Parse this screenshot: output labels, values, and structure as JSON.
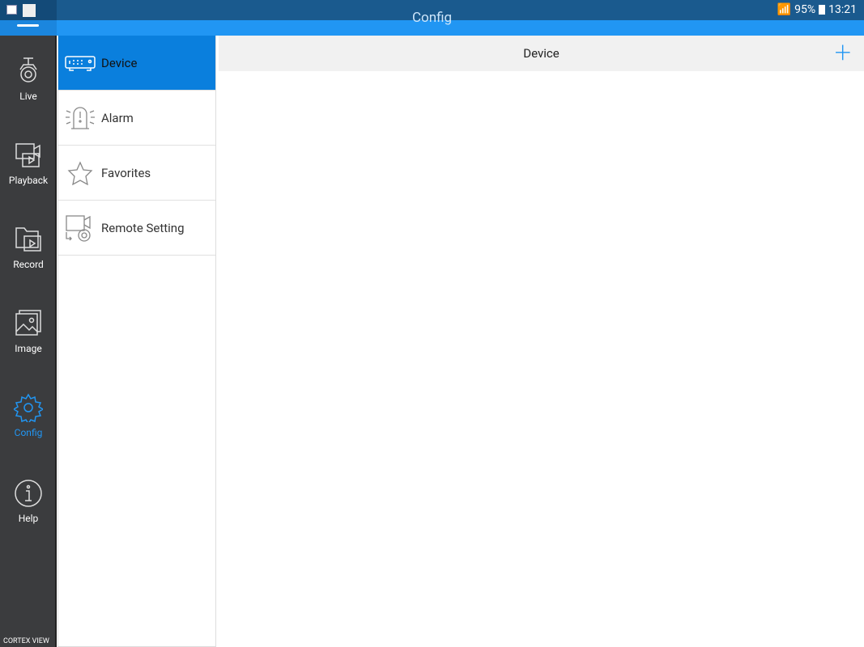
{
  "status": {
    "battery": "95%",
    "time": "13:21"
  },
  "header": {
    "title": "Config"
  },
  "sidebar": {
    "items": [
      {
        "label": "Live"
      },
      {
        "label": "Playback"
      },
      {
        "label": "Record"
      },
      {
        "label": "Image"
      },
      {
        "label": "Config",
        "active": true
      },
      {
        "label": "Help"
      }
    ],
    "brand": "CORTEX VIEW"
  },
  "menu": {
    "items": [
      {
        "label": "Device",
        "active": true
      },
      {
        "label": "Alarm"
      },
      {
        "label": "Favorites"
      },
      {
        "label": "Remote Setting"
      }
    ]
  },
  "main": {
    "title": "Device",
    "add_label": "+"
  },
  "colors": {
    "accent": "#2196f3",
    "selected": "#0a7fdd",
    "sidebar": "#3b3c3e"
  }
}
